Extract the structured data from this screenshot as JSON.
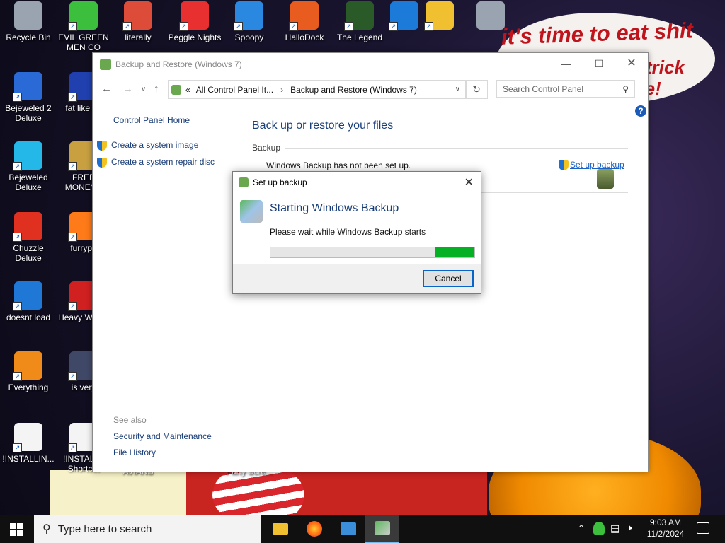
{
  "wallpaper": {
    "speech_line1": "it's time to eat shit",
    "speech_line2": "trick",
    "speech_line3": "te!"
  },
  "desktop_icons": [
    {
      "label": "Recycle Bin",
      "icon": "recycle-bin-icon",
      "color": "#9aa4b0"
    },
    {
      "label": "Bejeweled 2 Deluxe",
      "icon": "bejeweled2-icon",
      "color": "#2a6ad6"
    },
    {
      "label": "Bejeweled Deluxe",
      "icon": "bejeweled-icon",
      "color": "#24b8e8"
    },
    {
      "label": "Chuzzle Deluxe",
      "icon": "chuzzle-icon",
      "color": "#e03020"
    },
    {
      "label": "doesnt load",
      "icon": "thunderbird-icon",
      "color": "#1f78d6"
    },
    {
      "label": "Everything",
      "icon": "everything-search-icon",
      "color": "#f08a18"
    },
    {
      "label": "!INSTALLIN...",
      "icon": "text-document-icon",
      "color": "#f4f4f4"
    },
    {
      "label": "EVIL GREEN MEN CO",
      "icon": "green-men-icon",
      "color": "#3cbf3c"
    },
    {
      "label": "fat like da",
      "icon": "game-logo-icon",
      "color": "#2040b0"
    },
    {
      "label": "FREE MONEY.e",
      "icon": "money-bag-icon",
      "color": "#c8a040"
    },
    {
      "label": "furrypo",
      "icon": "firefox-icon",
      "color": "#ff7a18"
    },
    {
      "label": "Heavy Weap.",
      "icon": "radiation-icon",
      "color": "#d02020"
    },
    {
      "label": "is very",
      "icon": "shield-logo-icon",
      "color": "#404868"
    },
    {
      "label": "!INSTALL - Shortcut",
      "icon": "text-document-icon",
      "color": "#f4f4f4"
    },
    {
      "label": "literally",
      "icon": "chrome-icon",
      "color": "#dd4b39"
    },
    {
      "label": "Peggle Nights",
      "icon": "peggle-icon",
      "color": "#e83030"
    },
    {
      "label": "Spoopy",
      "icon": "network-computers-icon",
      "color": "#2a88e0"
    },
    {
      "label": "HalloDock",
      "icon": "hallodock-icon",
      "color": "#e85c20"
    },
    {
      "label": "The Legend",
      "icon": "legend-character-icon",
      "color": "#2a5a28"
    },
    {
      "label": "",
      "icon": "windows-drive-icon",
      "color": "#1c7ad8"
    },
    {
      "label": "",
      "icon": "file-explorer-icon",
      "color": "#f0c030"
    },
    {
      "label": "",
      "icon": "recycle-bin-icon",
      "color": "#9aa4b0"
    },
    {
      "label": "AVIANS",
      "icon": "",
      "color": ""
    },
    {
      "label": "Party Scre...",
      "icon": "",
      "color": ""
    }
  ],
  "window": {
    "title": "Backup and Restore (Windows 7)",
    "address_prefix": "«",
    "address_crumb1": "All Control Panel It...",
    "address_sep": "›",
    "address_crumb2": "Backup and Restore (Windows 7)",
    "search_placeholder": "Search Control Panel",
    "help_label": "?",
    "left_home": "Control Panel Home",
    "left_link1": "Create a system image",
    "left_link2": "Create a system repair disc",
    "see_also": "See also",
    "see_also_link1": "Security and Maintenance",
    "see_also_link2": "File History",
    "heading": "Back up or restore your files",
    "section_backup": "Backup",
    "backup_status": "Windows Backup has not been set up.",
    "setup_link": "Set up backup"
  },
  "dialog": {
    "title": "Set up backup",
    "heading": "Starting Windows Backup",
    "message": "Please wait while Windows Backup starts",
    "cancel_label": "Cancel",
    "progress": 0.19
  },
  "taskbar": {
    "search_placeholder": "Type here to search",
    "time": "9:03 AM",
    "date": "11/2/2024"
  },
  "colors": {
    "link": "#1a3e78",
    "heading": "#1a3e78",
    "progress": "#06b025",
    "accent": "#0a64c8"
  }
}
